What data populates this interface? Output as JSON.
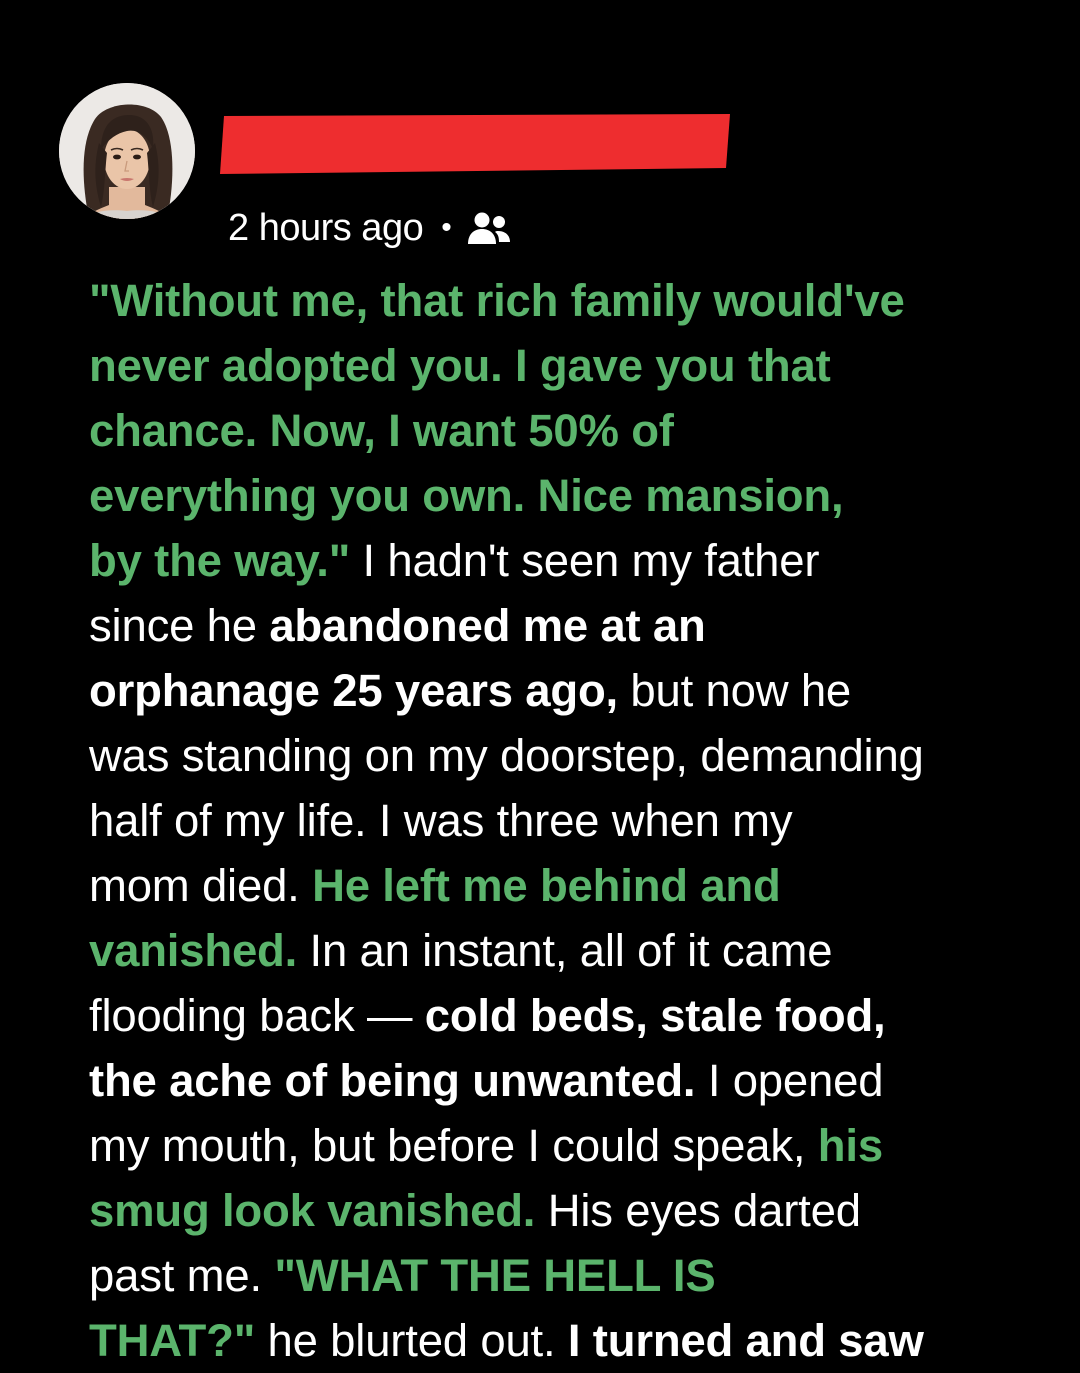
{
  "post": {
    "timestamp": "2 hours ago",
    "separator": "•",
    "audience_icon": "friends-icon",
    "colors": {
      "background": "#000000",
      "green_text": "#5bb46c",
      "name_redaction": "#ee2d2f"
    },
    "lines": [
      [
        {
          "t": "\"Without me, that rich family would've",
          "s": "green"
        }
      ],
      [
        {
          "t": "never adopted you. I gave you that",
          "s": "green"
        }
      ],
      [
        {
          "t": "chance. Now, I want 50% of",
          "s": "green"
        }
      ],
      [
        {
          "t": "everything you own. Nice mansion,",
          "s": "green"
        }
      ],
      [
        {
          "t": "by the way.\"",
          "s": "green"
        },
        {
          "t": " I hadn't seen my father",
          "s": "normal"
        }
      ],
      [
        {
          "t": "since he ",
          "s": "normal"
        },
        {
          "t": "abandoned me at an",
          "s": "bold"
        }
      ],
      [
        {
          "t": "orphanage 25 years ago,",
          "s": "bold"
        },
        {
          "t": " but now he",
          "s": "normal"
        }
      ],
      [
        {
          "t": "was standing on my doorstep, demanding",
          "s": "normal"
        }
      ],
      [
        {
          "t": "half of my life. I was three when my",
          "s": "normal"
        }
      ],
      [
        {
          "t": "mom died. ",
          "s": "normal"
        },
        {
          "t": "He left me behind and",
          "s": "green"
        }
      ],
      [
        {
          "t": "vanished.",
          "s": "green"
        },
        {
          "t": " In an instant, all of it came",
          "s": "normal"
        }
      ],
      [
        {
          "t": "flooding back — ",
          "s": "normal"
        },
        {
          "t": "cold beds, stale food,",
          "s": "bold"
        }
      ],
      [
        {
          "t": "the ache of being unwanted.",
          "s": "bold"
        },
        {
          "t": " I opened",
          "s": "normal"
        }
      ],
      [
        {
          "t": "my mouth, but before I could speak, ",
          "s": "normal"
        },
        {
          "t": "his",
          "s": "green"
        }
      ],
      [
        {
          "t": "smug look vanished.",
          "s": "green"
        },
        {
          "t": " His eyes darted",
          "s": "normal"
        }
      ],
      [
        {
          "t": "past me. ",
          "s": "normal"
        },
        {
          "t": "\"WHAT THE HELL IS",
          "s": "green"
        }
      ],
      [
        {
          "t": "THAT?\"",
          "s": "green"
        },
        {
          "t": " he blurted out. ",
          "s": "normal"
        },
        {
          "t": "I turned and saw",
          "s": "bold"
        }
      ]
    ]
  }
}
